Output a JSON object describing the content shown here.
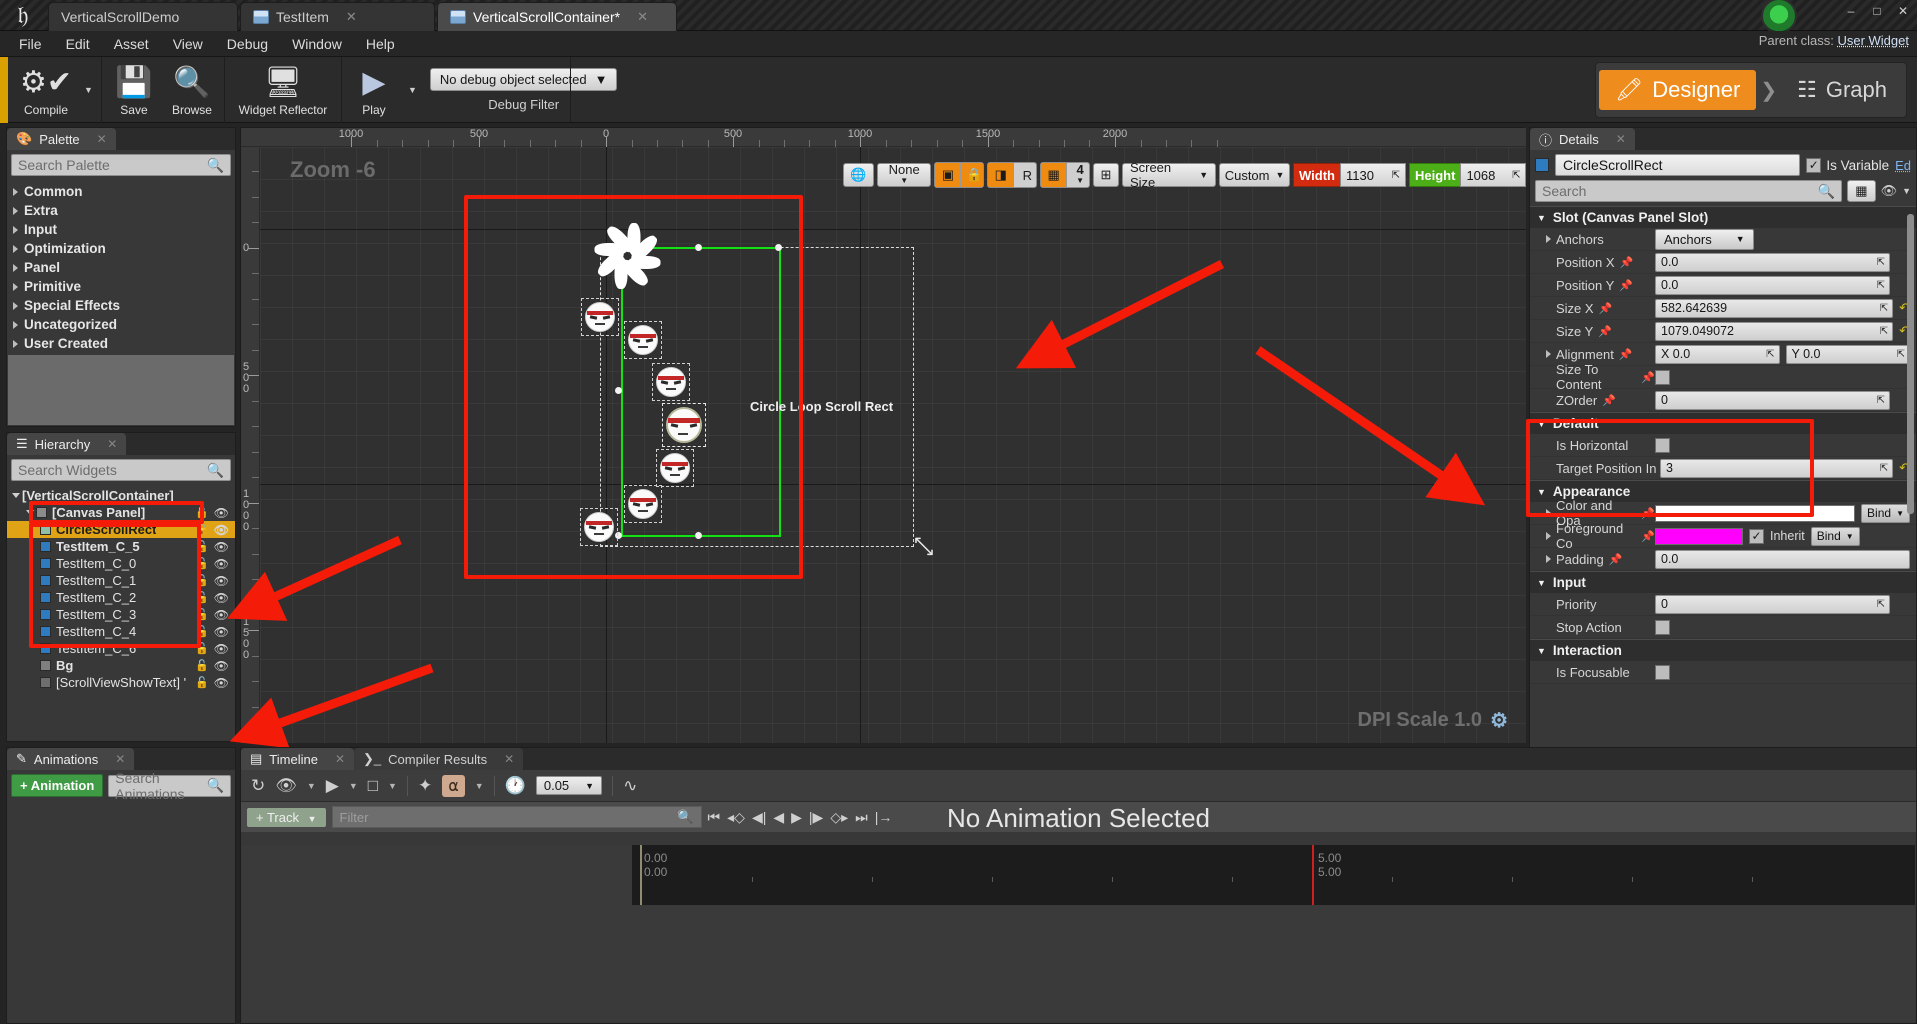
{
  "window": {
    "tabs": [
      {
        "label": "VerticalScrollDemo",
        "state": "inactive",
        "icon": "ue-icon"
      },
      {
        "label": "TestItem",
        "state": "inactive",
        "icon": "blueprint-icon"
      },
      {
        "label": "VerticalScrollContainer*",
        "state": "active",
        "icon": "blueprint-icon"
      }
    ],
    "controls": [
      "minimize",
      "maximize",
      "close"
    ]
  },
  "menu": {
    "items": [
      "File",
      "Edit",
      "Asset",
      "View",
      "Debug",
      "Window",
      "Help"
    ]
  },
  "parent_class": {
    "label": "Parent class:",
    "value": "User Widget"
  },
  "toolbar": {
    "compile": "Compile",
    "save": "Save",
    "browse": "Browse",
    "widget_reflector": "Widget Reflector",
    "play": "Play",
    "debug_object": "No debug object selected",
    "debug_filter": "Debug Filter"
  },
  "mode_switch": {
    "designer": "Designer",
    "graph": "Graph",
    "active": "Designer"
  },
  "palette": {
    "tab": "Palette",
    "search_placeholder": "Search Palette",
    "categories": [
      "Common",
      "Extra",
      "Input",
      "Optimization",
      "Panel",
      "Primitive",
      "Special Effects",
      "Uncategorized",
      "User Created"
    ]
  },
  "hierarchy": {
    "tab": "Hierarchy",
    "search_placeholder": "Search Widgets",
    "items": [
      {
        "label": "[VerticalScrollContainer]",
        "indent": 0,
        "expander": "down",
        "icon": "none",
        "selected": false
      },
      {
        "label": "[Canvas Panel]",
        "indent": 1,
        "expander": "down",
        "icon": "panel",
        "selected": false
      },
      {
        "label": "CircleScrollRect",
        "indent": 2,
        "expander": "none",
        "icon": "green-square",
        "selected": true
      },
      {
        "label": "TestItem_C_5",
        "indent": 2,
        "expander": "none",
        "icon": "blue-square",
        "selected": false
      },
      {
        "label": "TestItem_C_0",
        "indent": 2,
        "expander": "none",
        "icon": "blue-square",
        "selected": false
      },
      {
        "label": "TestItem_C_1",
        "indent": 2,
        "expander": "none",
        "icon": "blue-square",
        "selected": false
      },
      {
        "label": "TestItem_C_2",
        "indent": 2,
        "expander": "none",
        "icon": "blue-square",
        "selected": false
      },
      {
        "label": "TestItem_C_3",
        "indent": 2,
        "expander": "none",
        "icon": "blue-square",
        "selected": false
      },
      {
        "label": "TestItem_C_4",
        "indent": 2,
        "expander": "none",
        "icon": "blue-square",
        "selected": false
      },
      {
        "label": "TestItem_C_6",
        "indent": 2,
        "expander": "none",
        "icon": "blue-square",
        "selected": false
      },
      {
        "label": "Bg",
        "indent": 2,
        "expander": "none",
        "icon": "image",
        "selected": false
      },
      {
        "label": "[ScrollViewShowText] '",
        "indent": 2,
        "expander": "none",
        "icon": "text",
        "selected": false
      }
    ]
  },
  "animations": {
    "tab": "Animations",
    "add_button": "+ Animation",
    "search_placeholder": "Search Animations"
  },
  "canvas": {
    "zoom_label": "Zoom -6",
    "dpi_label": "DPI Scale 1.0",
    "widget_label": "Circle Loop Scroll Rect",
    "ruler_top_labels": [
      "1000",
      "500",
      "0",
      "500",
      "1000",
      "1500",
      "2000"
    ],
    "ruler_left_labels": [
      "0",
      "500",
      "1000",
      "1500"
    ],
    "designer_toolbar": {
      "localization": "globe-icon",
      "preview_dropdown": "None",
      "dashed_outline": "dashed-outline-icon",
      "lock": "lock-icon",
      "layout": "layout-icon",
      "r_button": "R",
      "grid": "grid-icon",
      "grid_size": "4",
      "fill_screen": "fill-screen-icon",
      "screen_size": "Screen Size",
      "aspect": "Custom",
      "width_label": "Width",
      "width_value": "1130",
      "height_label": "Height",
      "height_value": "1068"
    }
  },
  "details": {
    "tab": "Details",
    "widget_name": "CircleScrollRect",
    "is_variable_label": "Is Variable",
    "edit_link": "Ed",
    "search_placeholder": "Search",
    "sections": [
      {
        "title": "Slot (Canvas Panel Slot)",
        "highlighted": false,
        "rows": [
          {
            "label": "Anchors",
            "kind": "combo",
            "value": "Anchors",
            "expander": true,
            "pin": false,
            "revert": false
          },
          {
            "label": "Position X",
            "kind": "number",
            "value": "0.0",
            "expander": false,
            "pin": true,
            "revert": false
          },
          {
            "label": "Position Y",
            "kind": "number",
            "value": "0.0",
            "expander": false,
            "pin": true,
            "revert": false
          },
          {
            "label": "Size X",
            "kind": "number",
            "value": "582.642639",
            "expander": false,
            "pin": true,
            "revert": true
          },
          {
            "label": "Size Y",
            "kind": "number",
            "value": "1079.049072",
            "expander": false,
            "pin": true,
            "revert": true
          },
          {
            "label": "Alignment",
            "kind": "vec2",
            "value": "X  0.0",
            "value2": "Y  0.0",
            "expander": true,
            "pin": true,
            "revert": false
          },
          {
            "label": "Size To Content",
            "kind": "checkbox",
            "value": "",
            "checked": false,
            "expander": false,
            "pin": true,
            "revert": false
          },
          {
            "label": "ZOrder",
            "kind": "number",
            "value": "0",
            "expander": false,
            "pin": true,
            "revert": false
          }
        ]
      },
      {
        "title": "Default",
        "highlighted": true,
        "rows": [
          {
            "label": "Is Horizontal",
            "kind": "checkbox",
            "value": "",
            "checked": false,
            "expander": false,
            "pin": false,
            "revert": false
          },
          {
            "label": "Target Position In",
            "kind": "number",
            "value": "3",
            "expander": false,
            "pin": false,
            "revert": true
          }
        ]
      },
      {
        "title": "Appearance",
        "highlighted": false,
        "rows": [
          {
            "label": "Color and Opa",
            "kind": "color",
            "value": "#ffffff",
            "bind": "Bind",
            "expander": true,
            "pin": true,
            "revert": false
          },
          {
            "label": "Foreground Co",
            "kind": "color",
            "value": "#ff00ff",
            "inherit": "Inherit",
            "inherit_checked": true,
            "bind": "Bind",
            "expander": true,
            "pin": true,
            "revert": false
          },
          {
            "label": "Padding",
            "kind": "text",
            "value": "0.0",
            "expander": true,
            "pin": true,
            "revert": false
          }
        ]
      },
      {
        "title": "Input",
        "highlighted": false,
        "rows": [
          {
            "label": "Priority",
            "kind": "number",
            "value": "0",
            "expander": false,
            "pin": false,
            "revert": false
          },
          {
            "label": "Stop Action",
            "kind": "checkbox",
            "value": "",
            "checked": false,
            "expander": false,
            "pin": false,
            "revert": false
          }
        ]
      },
      {
        "title": "Interaction",
        "highlighted": false,
        "rows": [
          {
            "label": "Is Focusable",
            "kind": "checkbox",
            "value": "",
            "checked": false,
            "expander": false,
            "pin": false,
            "revert": false
          }
        ]
      }
    ]
  },
  "bottom": {
    "tabs": [
      {
        "label": "Timeline",
        "active": true
      },
      {
        "label": "Compiler Results",
        "active": false
      }
    ],
    "snap_value": "0.05",
    "track_button": "+ Track",
    "filter_placeholder": "Filter",
    "no_animation": "No Animation Selected",
    "time_start": "0.00",
    "time_start2": "0.00",
    "time_end": "5.00",
    "time_end2": "5.00"
  },
  "colors": {
    "accent_orange": "#ef8c1e",
    "selection_yellow": "#e0a316",
    "annotation_red": "#f41b09",
    "green_selection": "#14e114",
    "width_tag": "#d22b10",
    "height_tag": "#4caf17",
    "magenta": "#ff00ff"
  }
}
